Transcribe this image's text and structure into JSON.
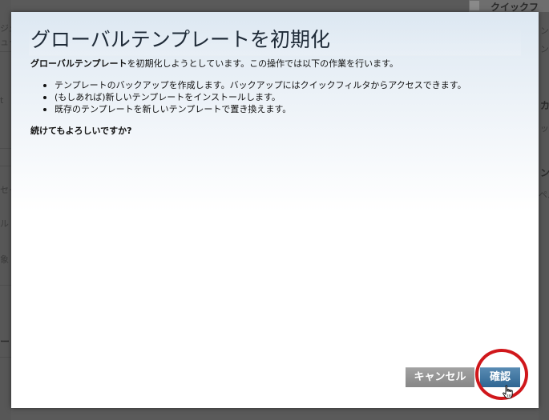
{
  "background": {
    "top_right_title": "クイックフ",
    "left_fragments": [
      "ジュ",
      "ュー",
      "t",
      "セー",
      "ルト",
      "象",
      "ート"
    ],
    "right_fragments": [
      "ン",
      "ン",
      "カ",
      "ッ",
      "ン",
      "ペル"
    ]
  },
  "dialog": {
    "title": "グローバルテンプレートを初期化",
    "intro_bold": "グローバルテンプレート",
    "intro_rest": "を初期化しようとしています。この操作では以下の作業を行います。",
    "steps": [
      "テンプレートのバックアップを作成します。バックアップにはクイックフィルタからアクセスできます。",
      "(もしあれば)新しいテンプレートをインストールします。",
      "既存のテンプレートを新しいテンプレートで置き換えます。"
    ],
    "question": "続けてもよろしいですか?"
  },
  "buttons": {
    "cancel_label": "キャンセル",
    "confirm_label": "確認"
  },
  "colors": {
    "highlight_ring": "#d0171b",
    "confirm_button": "#2f6692",
    "cancel_button": "#868686"
  },
  "icons": {
    "cursor": "hand-pointer-icon"
  }
}
